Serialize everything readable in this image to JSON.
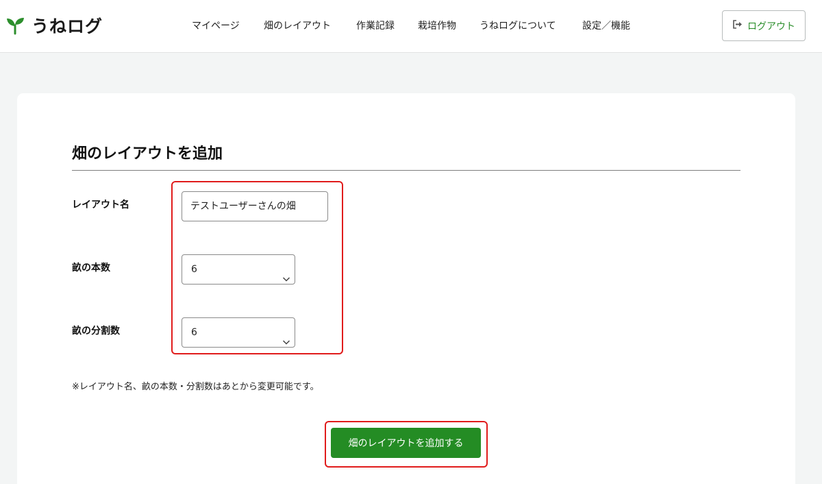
{
  "app": {
    "name": "うねログ",
    "logo_icon": "sprout-icon",
    "accent_color": "#248c24"
  },
  "nav": {
    "items": [
      {
        "label": "マイページ"
      },
      {
        "label": "畑のレイアウト"
      },
      {
        "label": "作業記録"
      },
      {
        "label": "栽培作物"
      },
      {
        "label": "うねログについて"
      },
      {
        "label": "設定／機能"
      }
    ],
    "logout_label": "ログアウト",
    "logout_icon": "sign-out-icon"
  },
  "form": {
    "title": "畑のレイアウトを追加",
    "layout_name_label": "レイアウト名",
    "layout_name_value": "テストユーザーさんの畑",
    "ridge_count_label": "畝の本数",
    "ridge_count_value": "6",
    "division_count_label": "畝の分割数",
    "division_count_value": "6",
    "note": "※レイアウト名、畝の本数・分割数はあとから変更可能です。",
    "submit_label": "畑のレイアウトを追加する",
    "highlight_color": "#e01b1b"
  }
}
